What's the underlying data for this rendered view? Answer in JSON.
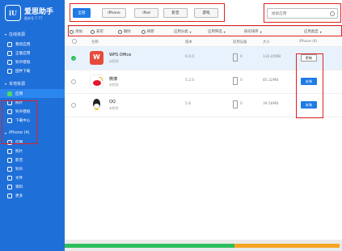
{
  "app": {
    "title": "爱思助手",
    "version": "版本号 7.77"
  },
  "sidebar": {
    "sections": [
      {
        "label": "在线资源",
        "items": [
          {
            "label": "我的应用"
          },
          {
            "label": "正版应用"
          },
          {
            "label": "铃声壁纸"
          },
          {
            "label": "固件下载"
          }
        ]
      },
      {
        "label": "本地资源",
        "items": [
          {
            "label": "应用"
          },
          {
            "label": "照片"
          },
          {
            "label": "铃声壁纸"
          },
          {
            "label": "下载中心"
          }
        ]
      },
      {
        "label": "iPhone (4)",
        "items": [
          {
            "label": "应用"
          },
          {
            "label": "照片"
          },
          {
            "label": "影音"
          },
          {
            "label": "铃声"
          },
          {
            "label": "文件"
          },
          {
            "label": "资料"
          },
          {
            "label": "更多"
          }
        ]
      }
    ]
  },
  "filters": {
    "tabs": [
      {
        "label": "全部"
      },
      {
        "label": "iPhone"
      },
      {
        "label": "iPad"
      },
      {
        "label": "影音"
      },
      {
        "label": "游戏"
      }
    ],
    "active": "全部"
  },
  "search": {
    "placeholder": "搜索应用"
  },
  "actions": [
    {
      "label": "添加"
    },
    {
      "label": "安装"
    },
    {
      "label": "删除"
    },
    {
      "label": "刷新"
    }
  ],
  "dropdowns": [
    {
      "label": "应用分类"
    },
    {
      "label": "应用筛选"
    },
    {
      "label": "按名排序"
    },
    {
      "label": "应用类型"
    }
  ],
  "table": {
    "columns": {
      "name": "名称",
      "version": "版本",
      "device": "适用设备",
      "size": "大小",
      "iphone": "iPhone (4)"
    },
    "rows": [
      {
        "name": "WPS Office",
        "sub": "未检测",
        "version": "6.0.0",
        "device_count": "0",
        "size": "134.45MB",
        "action": "更新",
        "selected": true
      },
      {
        "name": "微博",
        "sub": "未检测",
        "version": "5.2.0",
        "device_count": "0",
        "size": "85.32MB",
        "action": "安装",
        "selected": false
      },
      {
        "name": "QQ",
        "sub": "未检测",
        "version": "5.6",
        "device_count": "0",
        "size": "39.58MB",
        "action": "安装",
        "selected": false
      }
    ]
  },
  "colors": {
    "sidebar": "#1f6fd9",
    "accent": "#1e7be6",
    "highlight": "#e02020"
  }
}
